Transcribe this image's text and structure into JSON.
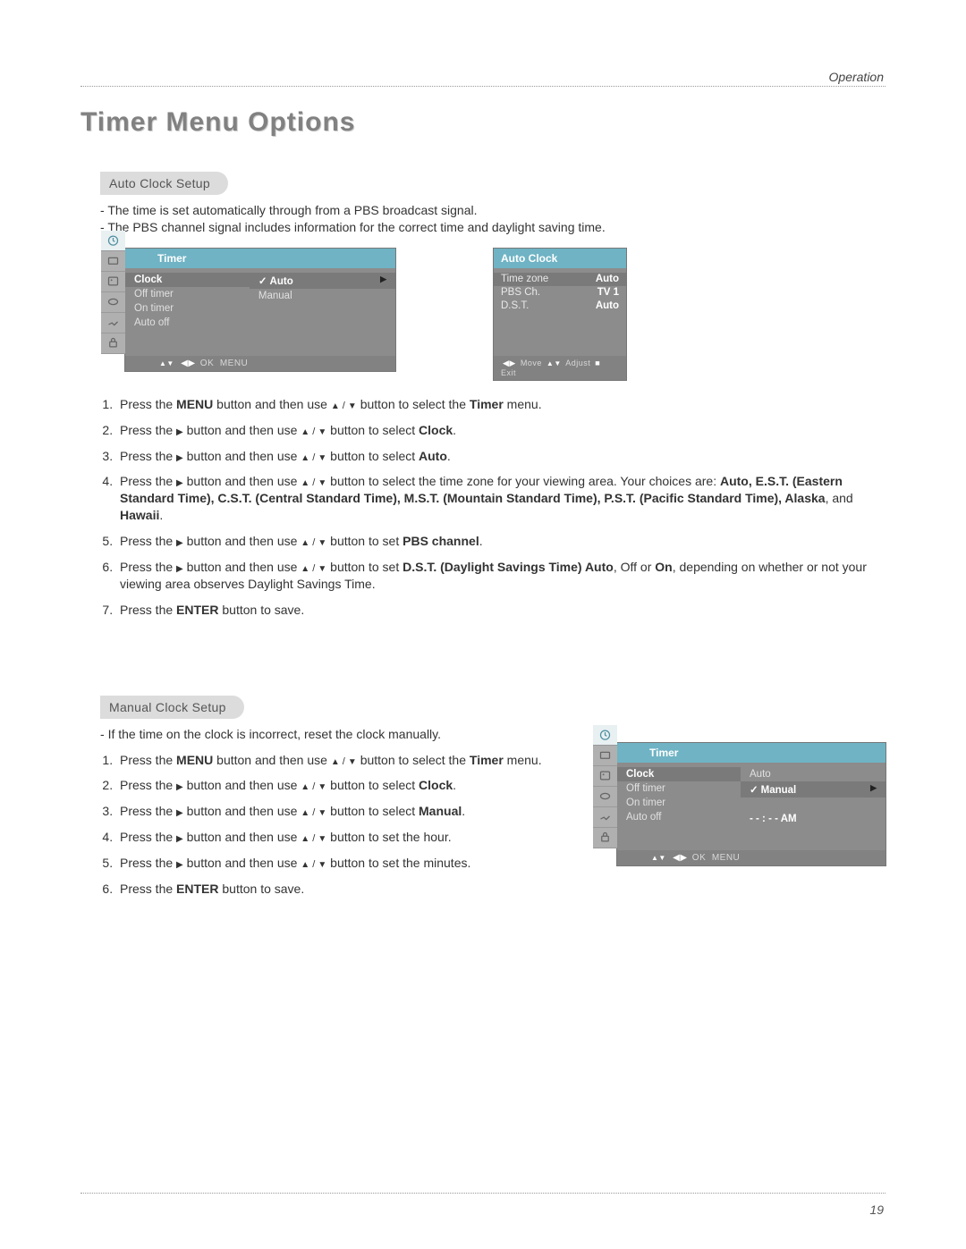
{
  "header": {
    "section": "Operation"
  },
  "title": "Timer Menu Options",
  "page_number": "19",
  "auto": {
    "pill": "Auto Clock Setup",
    "intro1": "The time is set automatically through from a PBS broadcast signal.",
    "intro2": "The PBS channel signal includes information for the correct time and daylight saving time.",
    "steps": {
      "s1a": "Press the ",
      "s1_menu": "MENU",
      "s1b": " button and then use ",
      "s1c": " button to select the ",
      "s1_timer": "Timer",
      "s1d": " menu.",
      "s2a": "Press the ",
      "s2b": " button and then use ",
      "s2c": " button to select ",
      "s2_clock": "Clock",
      "s2d": ".",
      "s3a": "Press the ",
      "s3b": " button and then use ",
      "s3c": " button to select ",
      "s3_auto": "Auto",
      "s3d": ".",
      "s4a": "Press the ",
      "s4b": " button and then use ",
      "s4c": " button to select the time zone for your viewing area. Your choices are: ",
      "s4_list": "Auto, E.S.T. (Eastern Standard Time), C.S.T. (Central Standard Time), M.S.T. (Mountain Standard Time), P.S.T. (Pacific Standard Time), Alaska",
      "s4_and": ", and ",
      "s4_hawaii": "Hawaii",
      "s4d": ".",
      "s5a": "Press the ",
      "s5b": " button and then use ",
      "s5c": " button to set ",
      "s5_pbs": "PBS channel",
      "s5d": ".",
      "s6a": "Press the ",
      "s6b": " button and then use ",
      "s6c": " button to set ",
      "s6_dst": "D.S.T. (Daylight Savings Time) Auto",
      "s6_off": ", Off",
      "s6_or": " or ",
      "s6_on": "On",
      "s6d": ", depending on whether or not your viewing area observes Daylight Savings Time.",
      "s7a": "Press the ",
      "s7_enter": "ENTER",
      "s7b": " button to save."
    },
    "osd1": {
      "title": "Timer",
      "left": [
        "Clock",
        "Off timer",
        "On timer",
        "Auto off"
      ],
      "right_auto": "Auto",
      "right_manual": "Manual",
      "footer_ok": "OK",
      "footer_menu": "MENU"
    },
    "osd2": {
      "title": "Auto Clock",
      "rows": [
        {
          "k": "Time zone",
          "v": "Auto"
        },
        {
          "k": "PBS Ch.",
          "v": "TV 1"
        },
        {
          "k": "D.S.T.",
          "v": "Auto"
        }
      ],
      "footer_move": "Move",
      "footer_adjust": "Adjust",
      "footer_exit": "Exit"
    }
  },
  "manual": {
    "pill": "Manual Clock Setup",
    "intro1": "If the time on the clock is incorrect, reset the clock manually.",
    "steps": {
      "s1a": "Press the ",
      "s1_menu": "MENU",
      "s1b": " button and then use ",
      "s1c": " button to select the ",
      "s1_timer": "Timer",
      "s1d": " menu.",
      "s2a": "Press the ",
      "s2b": " button and then use ",
      "s2c": " button to select ",
      "s2_clock": "Clock",
      "s2d": ".",
      "s3a": "Press the ",
      "s3b": " button and then use ",
      "s3c": " button to select ",
      "s3_manual": "Manual",
      "s3d": ".",
      "s4a": "Press the ",
      "s4b": " button and then use ",
      "s4c": " button to set the hour.",
      "s5a": "Press the ",
      "s5b": " button and then use ",
      "s5c": " button to set the minutes.",
      "s6a": "Press the ",
      "s6_enter": "ENTER",
      "s6b": " button to save."
    },
    "osd": {
      "title": "Timer",
      "left": [
        "Clock",
        "Off timer",
        "On timer",
        "Auto off"
      ],
      "right_auto": "Auto",
      "right_manual": "Manual",
      "time": "- - : - -   AM",
      "footer_ok": "OK",
      "footer_menu": "MENU"
    }
  }
}
